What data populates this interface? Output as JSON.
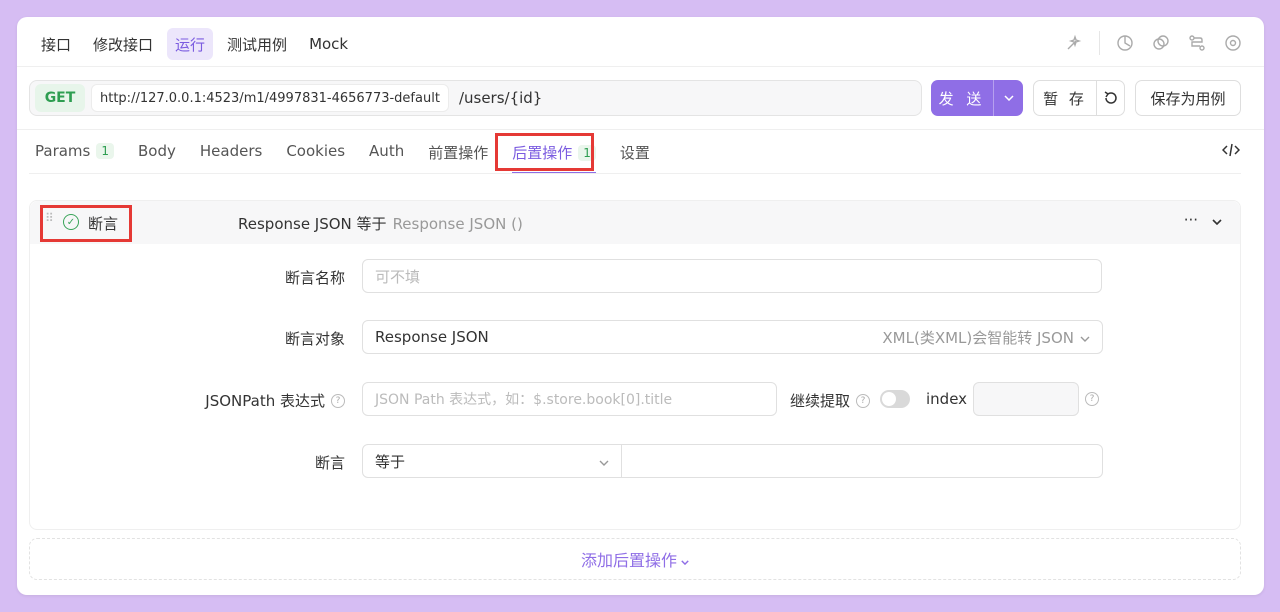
{
  "topnav": {
    "items": [
      {
        "label": "接口"
      },
      {
        "label": "修改接口"
      },
      {
        "label": "运行",
        "active": true
      },
      {
        "label": "测试用例"
      },
      {
        "label": "Mock"
      }
    ]
  },
  "request": {
    "method": "GET",
    "base_url": "http://127.0.0.1:4523/m1/4997831-4656773-default",
    "path": "/users/{id}",
    "send_label": "发 送",
    "temp_save_label": "暂 存",
    "save_as_case_label": "保存为用例"
  },
  "tabs": [
    {
      "label": "Params",
      "count": "1"
    },
    {
      "label": "Body"
    },
    {
      "label": "Headers"
    },
    {
      "label": "Cookies"
    },
    {
      "label": "Auth"
    },
    {
      "label": "前置操作"
    },
    {
      "label": "后置操作",
      "count": "1",
      "active": true
    },
    {
      "label": "设置"
    }
  ],
  "processor": {
    "title": "断言",
    "summary": "Response JSON 等于",
    "summary_hint": "Response JSON ()",
    "name_label": "断言名称",
    "name_placeholder": "可不填",
    "target_label": "断言对象",
    "target_value": "Response JSON",
    "target_hint": "XML(类XML)会智能转 JSON",
    "jsonpath_label": "JSONPath 表达式",
    "jsonpath_placeholder": "JSON Path 表达式，如：$.store.book[0].title",
    "continue_label": "继续提取",
    "index_label": "index",
    "index_value": "",
    "assert_label": "断言",
    "assert_op": "等于",
    "assert_value": ""
  },
  "add_post_label": "添加后置操作",
  "colors": {
    "accent": "#8f6ee6",
    "method_get": "#2e9e51",
    "highlight": "#e53935",
    "background": "#d6bdf3"
  }
}
